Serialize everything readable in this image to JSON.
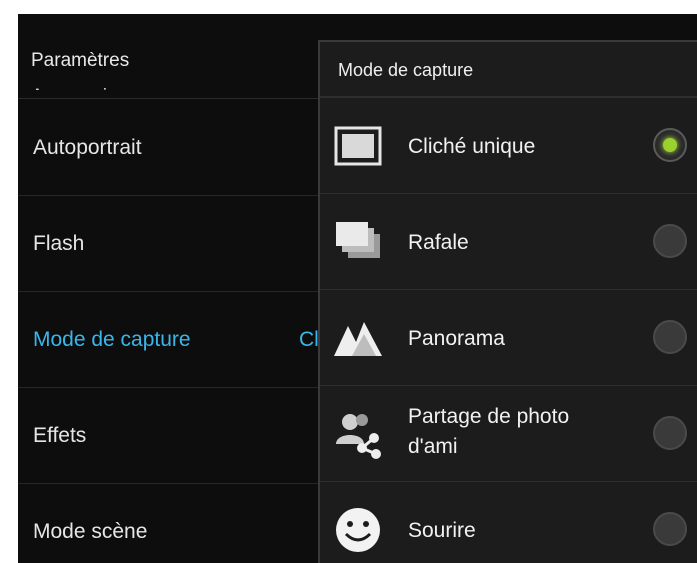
{
  "settings": {
    "title": "Paramètres",
    "cut_item": "Accessoires",
    "items": [
      {
        "label": "Autoportrait",
        "value": ""
      },
      {
        "label": "Flash",
        "value": ""
      },
      {
        "label": "Mode de capture",
        "value": "Cl"
      },
      {
        "label": "Effets",
        "value": ""
      },
      {
        "label": "Mode scène",
        "value": ""
      }
    ]
  },
  "dialog": {
    "title": "Mode de capture",
    "options": [
      {
        "label": "Cliché unique",
        "icon": "single-shot-icon",
        "selected": true
      },
      {
        "label": "Rafale",
        "icon": "burst-icon",
        "selected": false
      },
      {
        "label": "Panorama",
        "icon": "panorama-icon",
        "selected": false
      },
      {
        "label_line1": "Partage de photo",
        "label_line2": "d'ami",
        "icon": "share-photo-icon",
        "selected": false
      },
      {
        "label": "Sourire",
        "icon": "smile-icon",
        "selected": false
      }
    ]
  },
  "colors": {
    "accent": "#39b6ea",
    "radio_on": "#9ad12e",
    "background": "#0d0d0d",
    "dialog": "#1c1c1c"
  }
}
